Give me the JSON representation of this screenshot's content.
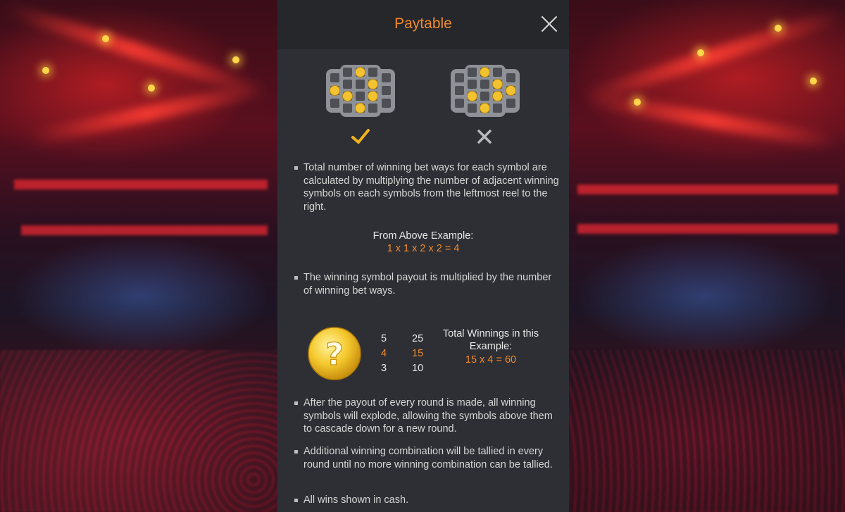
{
  "panel": {
    "title": "Paytable"
  },
  "examples": {
    "valid_mark": "check-icon",
    "invalid_mark": "cross-icon"
  },
  "rules": {
    "bullet1": "Total number of winning bet ways for each symbol are calculated by multiplying the number of adjacent winning symbols on each symbols from the leftmost reel to the right.",
    "example_title": "From Above Example:",
    "example_formula": "1 x 1 x 2 x 2 = 4",
    "bullet2": "The winning symbol payout is multiplied by the number of winning bet ways.",
    "bullet3": "After the payout of every round is made, all winning symbols will explode, allowing the symbols above them to cascade down for a new round.",
    "bullet4": "Additional winning combination will be tallied in every round until no more winning combination can be tallied.",
    "bullet5": "All wins shown in cash."
  },
  "paytable": {
    "symbol": "question-coin-icon",
    "rows": [
      {
        "count": "5",
        "payout": "25",
        "highlight": false
      },
      {
        "count": "4",
        "payout": "15",
        "highlight": true
      },
      {
        "count": "3",
        "payout": "10",
        "highlight": false
      }
    ],
    "total_label": "Total Winnings in this Example:",
    "total_formula": "15 x 4 = 60"
  },
  "colors": {
    "accent": "#f08a2c",
    "panel_bg": "#2e2f34",
    "header_bg": "#26272b",
    "text": "#d6d6d6",
    "coin": "#f2c230"
  }
}
